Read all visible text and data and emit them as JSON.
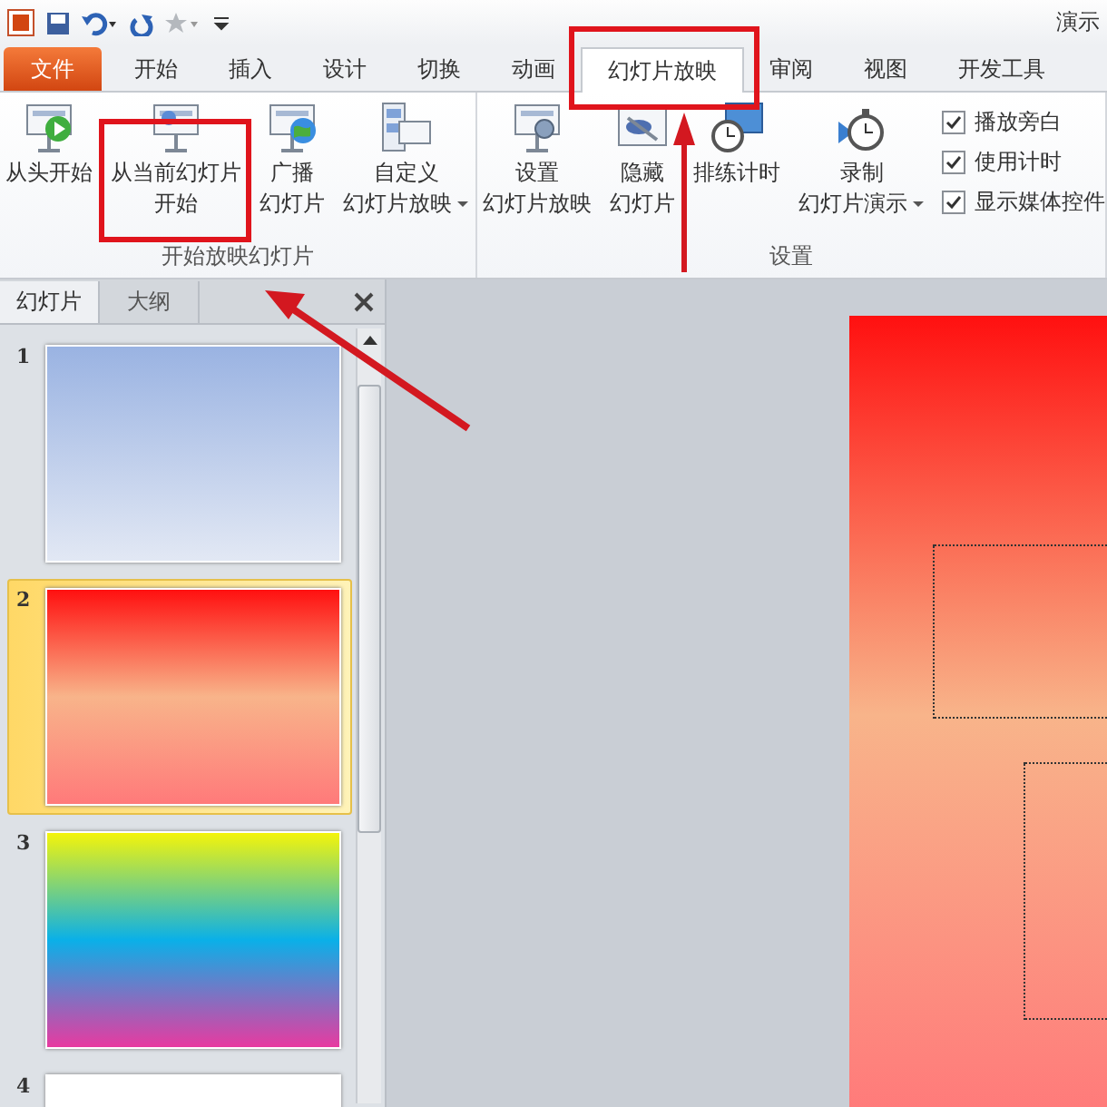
{
  "title_bar": {
    "title": "演示"
  },
  "tabs": [
    {
      "label": "文件",
      "kind": "file",
      "selected": false
    },
    {
      "label": "开始",
      "kind": "tab",
      "selected": false
    },
    {
      "label": "插入",
      "kind": "tab",
      "selected": false
    },
    {
      "label": "设计",
      "kind": "tab",
      "selected": false
    },
    {
      "label": "切换",
      "kind": "tab",
      "selected": false
    },
    {
      "label": "动画",
      "kind": "tab",
      "selected": false
    },
    {
      "label": "幻灯片放映",
      "kind": "tab",
      "selected": true
    },
    {
      "label": "审阅",
      "kind": "tab",
      "selected": false
    },
    {
      "label": "视图",
      "kind": "tab",
      "selected": false
    },
    {
      "label": "开发工具",
      "kind": "tab",
      "selected": false
    }
  ],
  "ribbon": {
    "groups": [
      {
        "label": "开始放映幻灯片",
        "buttons": [
          {
            "kind": "start",
            "lines": [
              "从头开始"
            ],
            "dropdown": false
          },
          {
            "kind": "current",
            "lines": [
              "从当前幻灯片",
              "开始"
            ],
            "dropdown": false
          },
          {
            "kind": "broadcast",
            "lines": [
              "广播",
              "幻灯片"
            ],
            "dropdown": false
          },
          {
            "kind": "custom",
            "lines": [
              "自定义",
              "幻灯片放映"
            ],
            "dropdown": true
          }
        ]
      },
      {
        "label": "设置",
        "buttons": [
          {
            "kind": "setup",
            "lines": [
              "设置",
              "幻灯片放映"
            ],
            "dropdown": false
          },
          {
            "kind": "hide",
            "lines": [
              "隐藏",
              "幻灯片"
            ],
            "dropdown": false
          },
          {
            "kind": "rehearse",
            "lines": [
              "排练计时"
            ],
            "dropdown": false
          },
          {
            "kind": "record",
            "lines": [
              "录制",
              "幻灯片演示"
            ],
            "dropdown": true
          }
        ],
        "checkboxes": [
          {
            "label": "播放旁白",
            "checked": true
          },
          {
            "label": "使用计时",
            "checked": true
          },
          {
            "label": "显示媒体控件",
            "checked": true
          }
        ]
      }
    ]
  },
  "slide_pane": {
    "tabs": [
      {
        "label": "幻灯片",
        "selected": true
      },
      {
        "label": "大纲",
        "selected": false
      }
    ],
    "slides": [
      {
        "number": "1",
        "selected": false,
        "kind": "sky"
      },
      {
        "number": "2",
        "selected": true,
        "kind": "sunset"
      },
      {
        "number": "3",
        "selected": false,
        "kind": "rainbow"
      },
      {
        "number": "4",
        "selected": false,
        "kind": "blank"
      }
    ]
  },
  "annotations": [
    {
      "kind": "frame"
    },
    {
      "kind": "frame"
    },
    {
      "kind": "arrow"
    },
    {
      "kind": "arrow"
    }
  ]
}
